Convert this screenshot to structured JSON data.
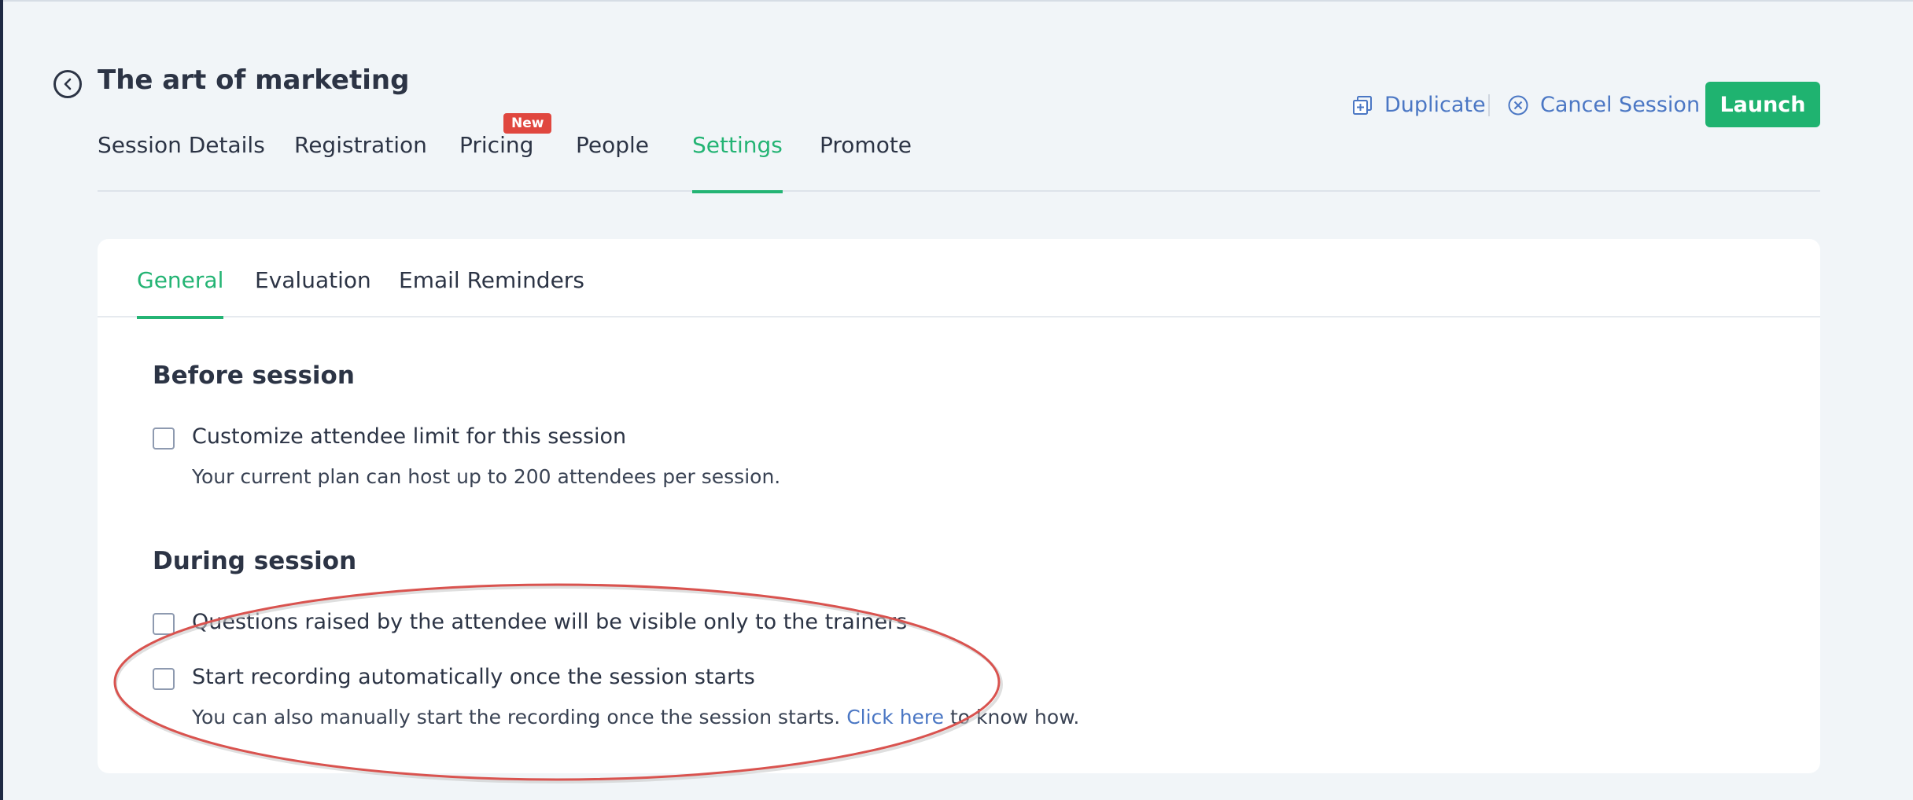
{
  "header": {
    "title": "The art of marketing",
    "back_icon": "back-arrow-icon"
  },
  "main_tabs": [
    {
      "label": "Session Details"
    },
    {
      "label": "Registration"
    },
    {
      "label": "Pricing",
      "badge": "New"
    },
    {
      "label": "People"
    },
    {
      "label": "Settings",
      "active": true
    },
    {
      "label": "Promote"
    }
  ],
  "actions": {
    "duplicate_label": "Duplicate",
    "duplicate_icon": "duplicate-icon",
    "cancel_label": "Cancel Session",
    "cancel_icon": "cancel-circle-icon",
    "launch_label": "Launch"
  },
  "sub_tabs": [
    {
      "label": "General",
      "active": true
    },
    {
      "label": "Evaluation"
    },
    {
      "label": "Email Reminders"
    }
  ],
  "sections": {
    "before": {
      "heading": "Before session",
      "option": {
        "label": "Customize attendee limit for this session",
        "checked": false,
        "help": "Your current plan can host up to 200 attendees per session."
      }
    },
    "during": {
      "heading": "During session",
      "options": [
        {
          "label": "Questions raised by the attendee will be visible only to the trainers",
          "checked": false
        },
        {
          "label": "Start recording automatically once the session starts",
          "checked": false
        }
      ],
      "help_prefix": "You can also manually start the recording once the session starts. ",
      "help_link": "Click here",
      "help_suffix": " to know how."
    }
  },
  "colors": {
    "accent_green": "#24b474",
    "link_blue": "#4b77c4",
    "badge_red": "#e0473f",
    "annotation_red": "#d9534f"
  }
}
